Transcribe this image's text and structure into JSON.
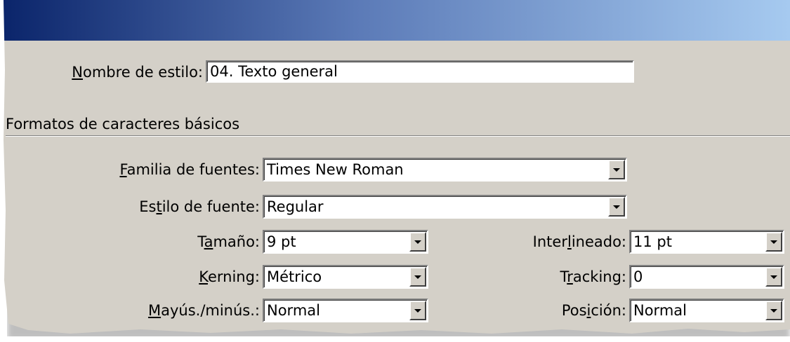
{
  "form": {
    "style_name": {
      "label_key": "N",
      "label_rest": "ombre de estilo:",
      "value": "04. Texto general"
    },
    "section_title": "Formatos de caracteres básicos",
    "font_family": {
      "label_key": "F",
      "label_rest": "amilia de fuentes:",
      "value": "Times New Roman"
    },
    "font_style": {
      "label_pre": "Es",
      "label_key": "t",
      "label_rest": "ilo de fuente:",
      "value": "Regular"
    },
    "size": {
      "label_pre": "T",
      "label_key": "a",
      "label_rest": "maño:",
      "value": "9 pt"
    },
    "leading": {
      "label_pre": "Inter",
      "label_key": "l",
      "label_rest": "ineado:",
      "value": "11 pt"
    },
    "kerning": {
      "label_key": "K",
      "label_rest": "erning:",
      "value": "Métrico"
    },
    "tracking": {
      "label_pre": "T",
      "label_key": "r",
      "label_rest": "acking:",
      "value": "0"
    },
    "case": {
      "label_key": "M",
      "label_rest": "ayús./minús.:",
      "value": "Normal"
    },
    "position": {
      "label_pre": "Pos",
      "label_key": "i",
      "label_rest": "ción:",
      "value": "Normal"
    }
  },
  "colors": {
    "panel": "#d4d0c8",
    "titlebar_start": "#0a246a",
    "titlebar_end": "#a6caf0"
  },
  "icons": {
    "dropdown": "chevron-down-icon"
  }
}
